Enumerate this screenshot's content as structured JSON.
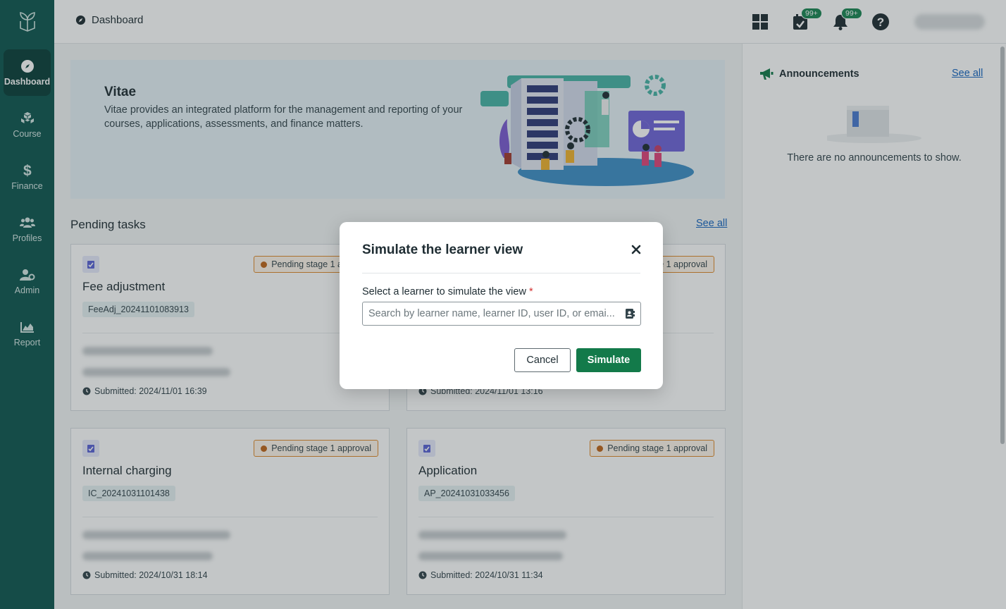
{
  "header": {
    "breadcrumb": "Dashboard",
    "tasks_badge": "99+",
    "notifications_badge": "99+"
  },
  "sidebar": {
    "items": [
      {
        "label": "Dashboard",
        "icon": "compass-icon",
        "active": true
      },
      {
        "label": "Course",
        "icon": "blocks-icon"
      },
      {
        "label": "Finance",
        "icon": "dollar-icon"
      },
      {
        "label": "Profiles",
        "icon": "users-icon"
      },
      {
        "label": "Admin",
        "icon": "user-gear-icon"
      },
      {
        "label": "Report",
        "icon": "area-chart-icon"
      }
    ]
  },
  "hero": {
    "title": "Vitae",
    "description": "Vitae provides an integrated platform for the management and reporting of your courses, applications, assessments, and finance matters."
  },
  "pending": {
    "title": "Pending tasks",
    "see_all": "See all",
    "cards": [
      {
        "title": "Fee adjustment",
        "code": "FeeAdj_20241101083913",
        "status": "Pending stage 1 approval",
        "submitted": "Submitted: 2024/11/01 16:39"
      },
      {
        "title": "",
        "code": "",
        "status": "Pending stage 1 approval",
        "submitted": "Submitted: 2024/11/01 13:16"
      },
      {
        "title": "Internal charging",
        "code": "IC_20241031101438",
        "status": "Pending stage 1 approval",
        "submitted": "Submitted: 2024/10/31 18:14"
      },
      {
        "title": "Application",
        "code": "AP_20241031033456",
        "status": "Pending stage 1 approval",
        "submitted": "Submitted: 2024/10/31 11:34"
      }
    ]
  },
  "announcements": {
    "title": "Announcements",
    "see_all": "See all",
    "empty": "There are no announcements to show."
  },
  "modal": {
    "title": "Simulate the learner view",
    "field_label": "Select a learner to simulate the view",
    "required_mark": "*",
    "placeholder": "Search by learner name, learner ID, user ID, or emai...",
    "value": "",
    "cancel": "Cancel",
    "simulate": "Simulate"
  },
  "colors": {
    "sidebar": "#0f5750",
    "primary_button": "#137a4a",
    "status_border": "#e08a2c",
    "link": "#1565c0"
  }
}
